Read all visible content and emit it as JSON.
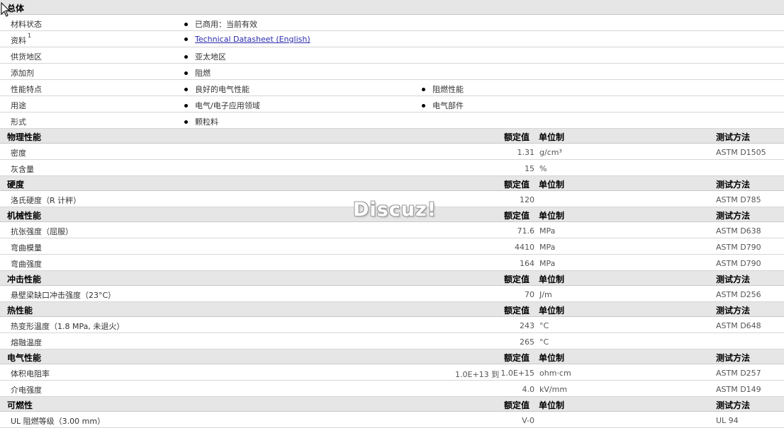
{
  "general": {
    "title": "总体",
    "rows": [
      {
        "label": "材料状态",
        "items": [
          "已商用：当前有效"
        ]
      },
      {
        "label": "资料",
        "sup": "1",
        "items": [
          "Technical Datasheet (English)"
        ],
        "link": true
      },
      {
        "label": "供货地区",
        "items": [
          "亚太地区"
        ]
      },
      {
        "label": "添加剂",
        "items": [
          "阻燃"
        ]
      },
      {
        "label": "性能特点",
        "items": [
          "良好的电气性能",
          "阻燃性能"
        ]
      },
      {
        "label": "用途",
        "items": [
          "电气/电子应用领域",
          "电气部件"
        ]
      },
      {
        "label": "形式",
        "items": [
          "颗粒料"
        ]
      }
    ]
  },
  "headers": {
    "nominal": "额定值",
    "unit": "单位制",
    "test": "测试方法"
  },
  "sections": [
    {
      "title": "物理性能",
      "rows": [
        {
          "label": "密度",
          "value": "1.31",
          "unit": "g/cm³",
          "test": "ASTM D1505"
        },
        {
          "label": "灰含量",
          "value": "15",
          "unit": "%",
          "test": ""
        }
      ]
    },
    {
      "title": "硬度",
      "rows": [
        {
          "label": "洛氏硬度（R 计秤）",
          "value": "120",
          "unit": "",
          "test": "ASTM D785"
        }
      ]
    },
    {
      "title": "机械性能",
      "rows": [
        {
          "label": "抗张强度（屈服）",
          "value": "71.6",
          "unit": "MPa",
          "test": "ASTM D638"
        },
        {
          "label": "弯曲模量",
          "value": "4410",
          "unit": "MPa",
          "test": "ASTM D790"
        },
        {
          "label": "弯曲强度",
          "value": "164",
          "unit": "MPa",
          "test": "ASTM D790"
        }
      ]
    },
    {
      "title": "冲击性能",
      "rows": [
        {
          "label": "悬壁梁缺口冲击强度（23°C）",
          "value": "70",
          "unit": "J/m",
          "test": "ASTM D256"
        }
      ]
    },
    {
      "title": "热性能",
      "rows": [
        {
          "label": "热变形温度（1.8 MPa, 未退火）",
          "value": "243",
          "unit": "°C",
          "test": "ASTM D648"
        },
        {
          "label": "熔融温度",
          "value": "265",
          "unit": "°C",
          "test": ""
        }
      ]
    },
    {
      "title": "电气性能",
      "rows": [
        {
          "label": "体积电阻率",
          "value_from": "1.0E+13 到",
          "value": "1.0E+15",
          "unit": "ohm·cm",
          "test": "ASTM D257"
        },
        {
          "label": "介电强度",
          "value": "4.0",
          "unit": "kV/mm",
          "test": "ASTM D149"
        }
      ]
    },
    {
      "title": "可燃性",
      "rows": [
        {
          "label": "UL 阻燃等级（3.00 mm）",
          "value": "V-0",
          "unit": "",
          "test": "UL 94"
        }
      ]
    }
  ],
  "watermark": "Discuz!",
  "icons": {
    "cursor": "arrow-cursor-icon",
    "bullet": "bullet-dot-icon"
  }
}
